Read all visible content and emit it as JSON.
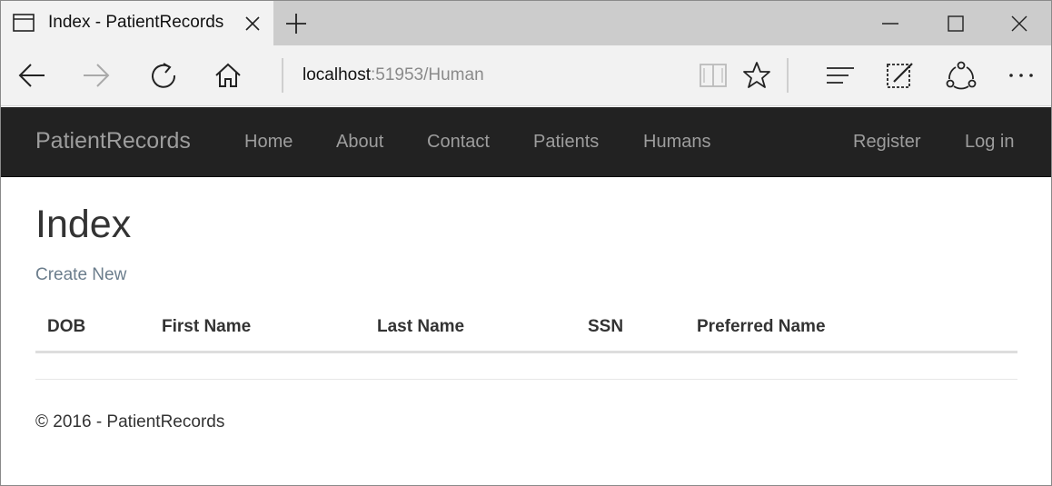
{
  "browser": {
    "tab_title": "Index - PatientRecords",
    "address_host": "localhost",
    "address_rest": ":51953/Human",
    "icons": {
      "tab": "tab-page-icon",
      "close": "close-icon",
      "new_tab": "plus-icon",
      "minimize": "minimize-icon",
      "maximize": "maximize-icon",
      "window_close": "close-icon",
      "back": "back-arrow-icon",
      "forward": "forward-arrow-icon",
      "refresh": "refresh-icon",
      "home": "home-icon",
      "reading_view": "book-icon",
      "favorite": "star-icon",
      "hub": "hub-icon",
      "notes": "pen-note-icon",
      "share": "share-icon",
      "more": "more-icon"
    }
  },
  "navbar": {
    "brand": "PatientRecords",
    "links": [
      "Home",
      "About",
      "Contact",
      "Patients",
      "Humans"
    ],
    "right_links": [
      "Register",
      "Log in"
    ],
    "background": "#222222",
    "link_color": "#9d9d9d"
  },
  "main": {
    "title": "Index",
    "create_link": "Create New",
    "table": {
      "columns": [
        "DOB",
        "First Name",
        "Last Name",
        "SSN",
        "Preferred Name"
      ],
      "rows": []
    }
  },
  "footer": {
    "text": "© 2016 - PatientRecords"
  }
}
